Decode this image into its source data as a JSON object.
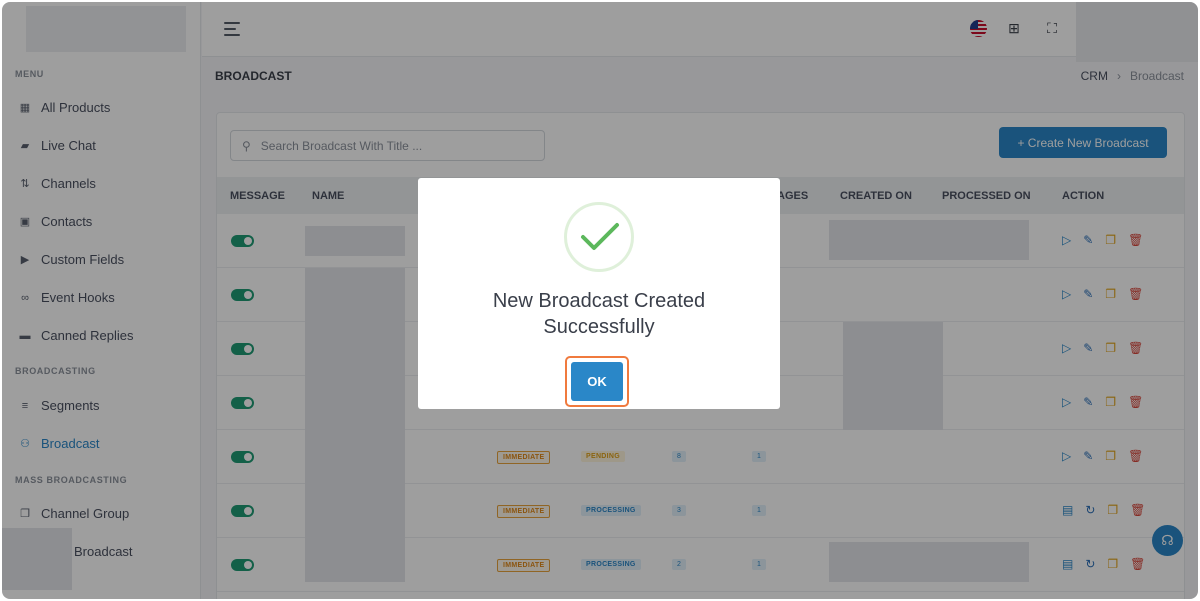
{
  "sidebar": {
    "menu_title": "MENU",
    "items": [
      {
        "label": "All Products",
        "icon": "grid-icon"
      },
      {
        "label": "Live Chat",
        "icon": "chat-icon"
      },
      {
        "label": "Channels",
        "icon": "channels-icon"
      },
      {
        "label": "Contacts",
        "icon": "contacts-icon"
      },
      {
        "label": "Custom Fields",
        "icon": "tag-icon"
      },
      {
        "label": "Event Hooks",
        "icon": "link-icon"
      },
      {
        "label": "Canned Replies",
        "icon": "message-icon"
      }
    ],
    "broadcasting_title": "BROADCASTING",
    "broadcasting_items": [
      {
        "label": "Segments",
        "icon": "filter-icon"
      },
      {
        "label": "Broadcast",
        "icon": "broadcast-icon"
      }
    ],
    "mass_title": "MASS BROADCASTING",
    "mass_items": [
      {
        "label": "Channel Group",
        "icon": "copy-icon"
      },
      {
        "label": "Broadcast",
        "icon": "broadcast-icon"
      }
    ]
  },
  "header": {
    "page_title": "BROADCAST",
    "breadcrumb": [
      "CRM",
      "Broadcast"
    ],
    "breadcrumb_sep": "›"
  },
  "toolbar": {
    "search_placeholder": "Search Broadcast With Title ...",
    "create_label": "+ Create New Broadcast"
  },
  "table": {
    "columns": [
      "MESSAGE",
      "NAME",
      "AGES",
      "CREATED ON",
      "PROCESSED ON",
      "ACTION"
    ],
    "rows": [
      {
        "type": "",
        "status": "",
        "n1": "",
        "n2": ""
      },
      {
        "type": "",
        "status": "",
        "n1": "",
        "n2": ""
      },
      {
        "type": "",
        "status": "",
        "n1": "",
        "n2": ""
      },
      {
        "type": "",
        "status": "",
        "n1": "",
        "n2": ""
      },
      {
        "type": "IMMEDIATE",
        "status": "PENDING",
        "n1": "8",
        "n2": "1"
      },
      {
        "type": "IMMEDIATE",
        "status": "PROCESSING",
        "n1": "3",
        "n2": "1"
      },
      {
        "type": "IMMEDIATE",
        "status": "PROCESSING",
        "n1": "2",
        "n2": "1"
      }
    ]
  },
  "modal": {
    "title": "New Broadcast Created Successfully",
    "ok_label": "OK"
  },
  "colors": {
    "accent": "#2a87c8",
    "toggle_on": "#1f9b74",
    "success": "#5cb85c",
    "focus_ring": "#f07a3e"
  }
}
